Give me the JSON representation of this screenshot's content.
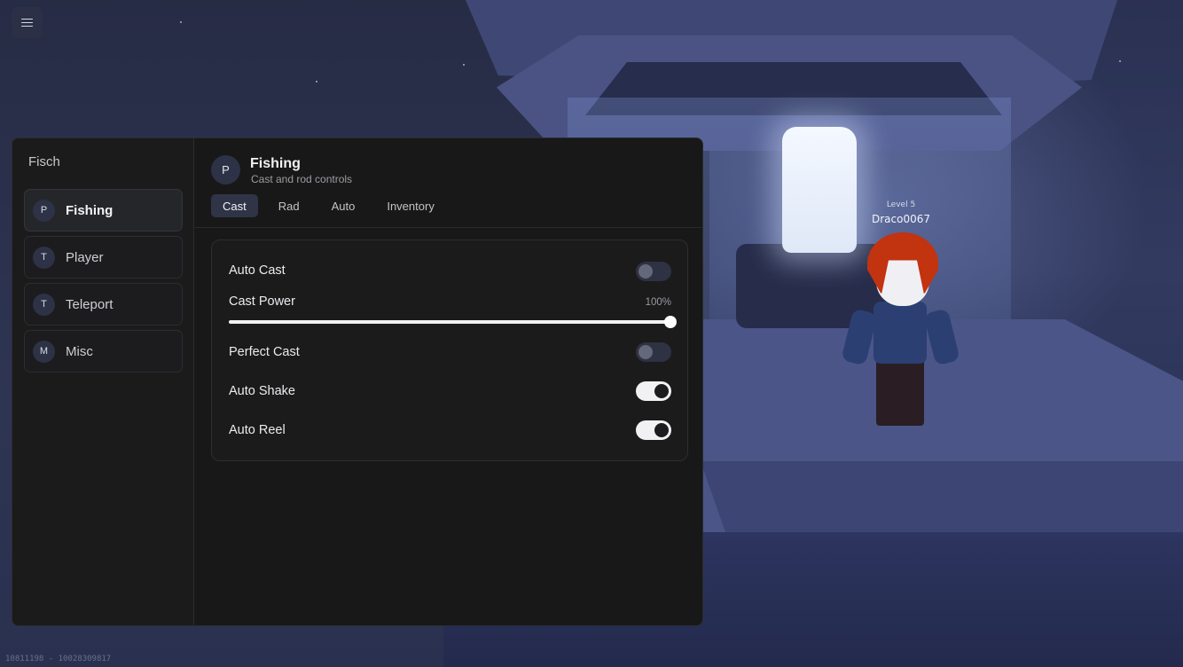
{
  "scene": {
    "player_level": "Level 5",
    "player_name": "Draco0067",
    "version_text": "10811198 - 10028309817"
  },
  "menu_toggle": {
    "icon": "hamburger-icon"
  },
  "window": {
    "app_title": "Fisch",
    "sidebar": {
      "items": [
        {
          "badge": "P",
          "label": "Fishing",
          "active": true
        },
        {
          "badge": "T",
          "label": "Player",
          "active": false
        },
        {
          "badge": "T",
          "label": "Teleport",
          "active": false
        },
        {
          "badge": "M",
          "label": "Misc",
          "active": false
        }
      ]
    },
    "page": {
      "badge": "P",
      "title": "Fishing",
      "subtitle": "Cast and rod controls"
    },
    "tabs": [
      {
        "label": "Cast",
        "active": true
      },
      {
        "label": "Rad",
        "active": false
      },
      {
        "label": "Auto",
        "active": false
      },
      {
        "label": "Inventory",
        "active": false
      }
    ],
    "settings": {
      "auto_cast": {
        "label": "Auto Cast",
        "enabled": false
      },
      "cast_power": {
        "label": "Cast Power",
        "value_text": "100%",
        "value": 1.0
      },
      "perfect_cast": {
        "label": "Perfect Cast",
        "enabled": false
      },
      "auto_shake": {
        "label": "Auto Shake",
        "enabled": true
      },
      "auto_reel": {
        "label": "Auto Reel",
        "enabled": true
      }
    }
  },
  "colors": {
    "window_bg": "#181818",
    "accent_badge": "#2d3246",
    "toggle_on": "#f1f1f4",
    "toggle_off": "#2e3242"
  }
}
